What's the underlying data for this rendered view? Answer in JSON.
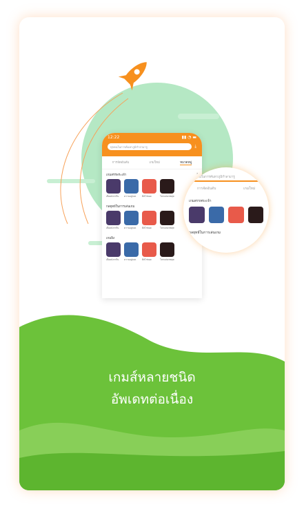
{
  "phone": {
    "time": "12:22",
    "search_placeholder": "ทุกคนในการค้นหาภูมิกำลามารู",
    "tabs": [
      "การจัดอันดับ",
      "เกมใหม่",
      "หมวดหมู่"
    ],
    "sections": [
      {
        "title": "เกมสรรพระเจ้า",
        "games": [
          "เลือดมังกรจีน",
          "ความอยู่รอด",
          "ตีลไก่ทอด",
          "โลกแห่งเทพยุทธ์"
        ]
      },
      {
        "title": "กลยุทธ์ในการเล่นเกม",
        "games": [
          "เลือดมังกรจีน",
          "ความอยู่รอด",
          "ตีลไก่ทอด",
          "โลกแห่งเทพยุทธ์"
        ]
      },
      {
        "title": "เกมยิง",
        "games": [
          "เลือดมังกรจีน",
          "ความอยู่รอด",
          "ตีลไก่ทอด",
          "โลกแห่งเทพยุทธ์"
        ]
      }
    ]
  },
  "headline": [
    "เกมส์หลายชนิด",
    "อัพเดทต่อเนื่อง"
  ],
  "colors": {
    "orange": "#f7901e",
    "green": "#6cc23a",
    "mint": "#b5e8c4"
  }
}
